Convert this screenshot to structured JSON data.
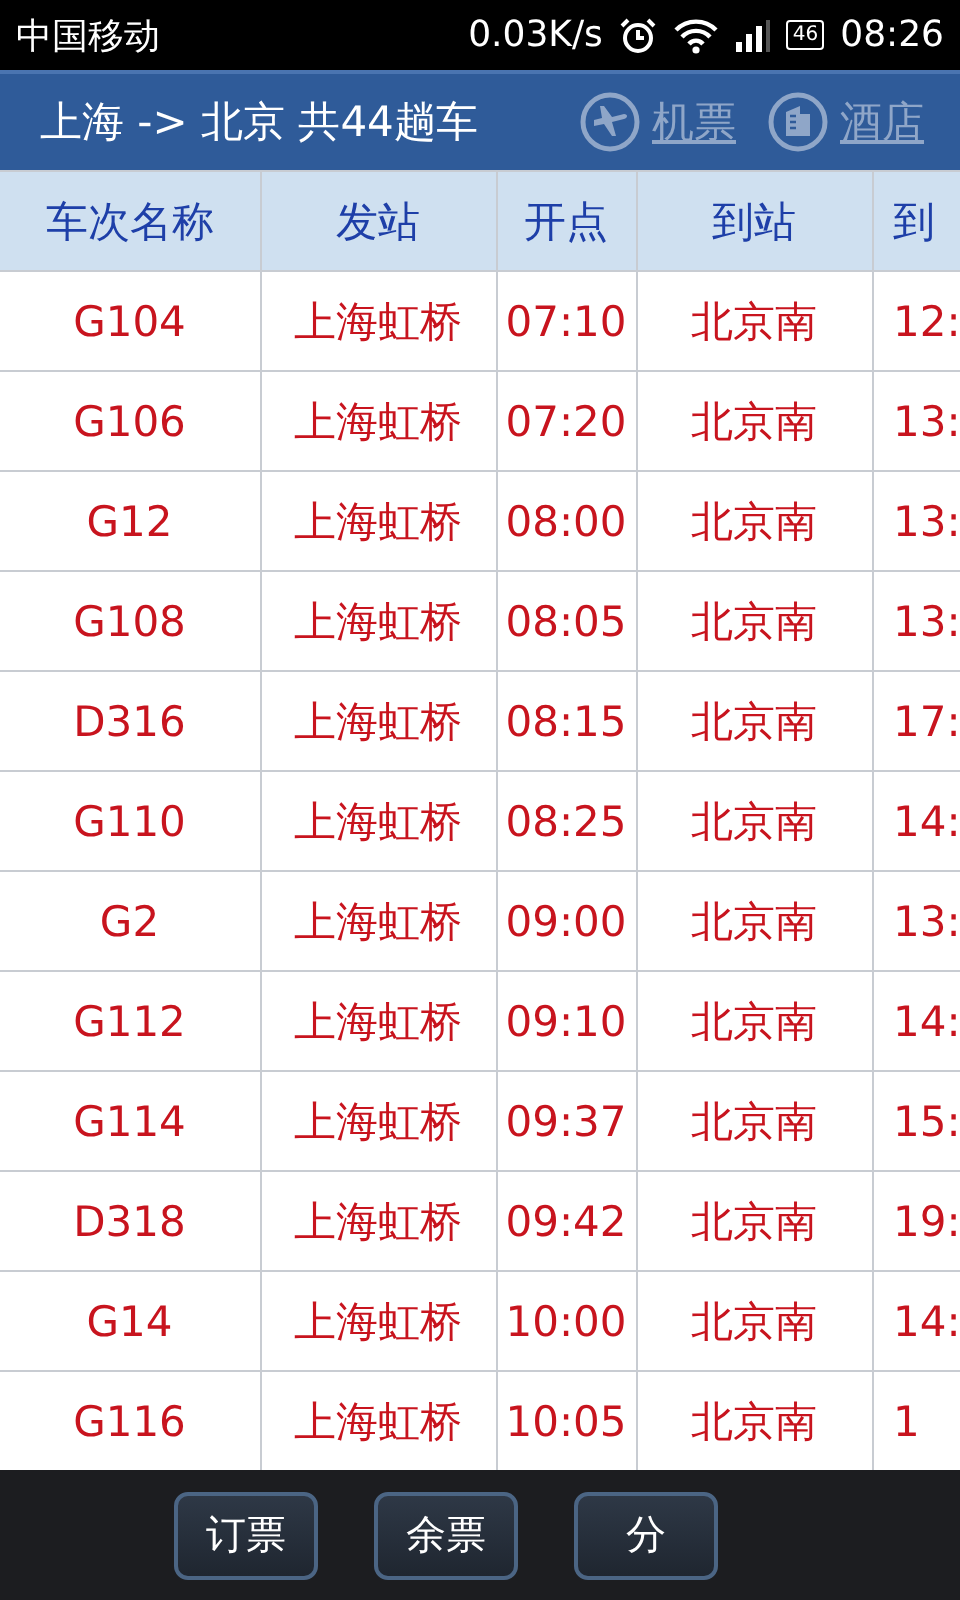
{
  "status_bar": {
    "carrier": "中国移动",
    "speed": "0.03K/s",
    "battery": "46",
    "time": "08:26"
  },
  "title_bar": {
    "title": "上海 -> 北京 共44趟车",
    "links": [
      {
        "kind": "plane",
        "label": "机票"
      },
      {
        "kind": "hotel",
        "label": "酒店"
      }
    ]
  },
  "table": {
    "columns": [
      "车次名称",
      "发站",
      "开点",
      "到站",
      "到"
    ],
    "rows": [
      [
        "G104",
        "上海虹桥",
        "07:10",
        "北京南",
        "12:"
      ],
      [
        "G106",
        "上海虹桥",
        "07:20",
        "北京南",
        "13:"
      ],
      [
        "G12",
        "上海虹桥",
        "08:00",
        "北京南",
        "13:"
      ],
      [
        "G108",
        "上海虹桥",
        "08:05",
        "北京南",
        "13:"
      ],
      [
        "D316",
        "上海虹桥",
        "08:15",
        "北京南",
        "17:"
      ],
      [
        "G110",
        "上海虹桥",
        "08:25",
        "北京南",
        "14:"
      ],
      [
        "G2",
        "上海虹桥",
        "09:00",
        "北京南",
        "13:"
      ],
      [
        "G112",
        "上海虹桥",
        "09:10",
        "北京南",
        "14:"
      ],
      [
        "G114",
        "上海虹桥",
        "09:37",
        "北京南",
        "15:"
      ],
      [
        "D318",
        "上海虹桥",
        "09:42",
        "北京南",
        "19:"
      ],
      [
        "G14",
        "上海虹桥",
        "10:00",
        "北京南",
        "14:"
      ],
      [
        "G116",
        "上海虹桥",
        "10:05",
        "北京南",
        "1"
      ]
    ]
  },
  "bottom_bar": {
    "buttons": [
      "订票",
      "余票",
      "分"
    ]
  }
}
